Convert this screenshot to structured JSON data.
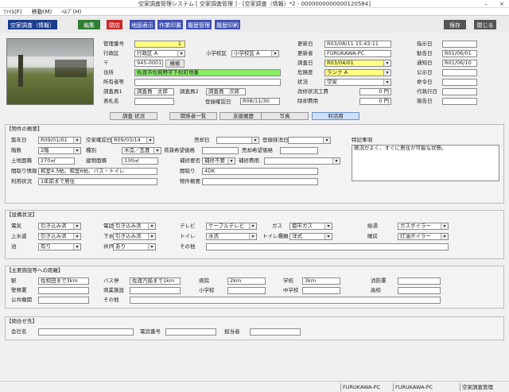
{
  "window": {
    "title": "空家調査管理システム [ 空家調査管理 ] - [空家調査（情報）*2 - 0000000000000120584]",
    "minimize": "–",
    "close": "×"
  },
  "menu": [
    "ﾌｧｲﾙ(F)",
    "移動(M)",
    "ﾍﾙﾌﾟ(H)"
  ],
  "toolbar": {
    "title": "空家調査（情報）",
    "edit": "編集",
    "close_page": "閉店",
    "map": "地図表示",
    "print_list": "作業印書",
    "history": "履歴管理",
    "history_print": "履歴印刷",
    "save": "保存",
    "close": "閉じる"
  },
  "photo_alt": "現地写真",
  "basic": {
    "mgmt_no_label": "管理番号",
    "mgmt_no": "1",
    "ward_label": "行政区",
    "ward": "行政区 A",
    "school_label": "小学校区",
    "school": "小学校区 A",
    "zip_label": "〒",
    "zip": "945-0001",
    "zip_btn": "検索",
    "addr_label": "住所",
    "addr": "佐渡市佐賀野字下松町地番",
    "owner_label": "所有者等",
    "surveyor1_label": "調査員1",
    "surveyor1": "調査員　太郎",
    "surveyor2_label": "調査員2",
    "surveyor2": "調査員　次郎",
    "remarks_label": "表札名",
    "regdate_label": "登録確認日",
    "regdate": "R08/11/30"
  },
  "right": {
    "upd_label": "更新日",
    "upd": "R03/08/11 15:43:11",
    "upd_by_label": "更新者",
    "upd_by": "FURUKAWA-PC",
    "survey_date_label": "調査日",
    "survey_date": "R03/04/01",
    "danger_label": "危険度",
    "danger": "ランク A",
    "status_label": "状況",
    "status": "空家",
    "repair_label": "改修状況工費",
    "repair": "0 円",
    "demol_label": "除却費用",
    "demol": "0 円",
    "d1_label": "指示日",
    "d1": "",
    "d2_label": "勧告日",
    "d2": "R01/06/01",
    "d3_label": "通知日",
    "d3": "R01/06/10",
    "d4_label": "公示日",
    "d4": "",
    "d5_label": "命令日",
    "d5": "",
    "d6_label": "代執行日",
    "d6": "",
    "d7_label": "報告日",
    "d7": ""
  },
  "actions": [
    "調査 状況",
    "関係者一覧",
    "支援履歴",
    "写真",
    "利活用"
  ],
  "prop": {
    "title": "【物件の概要】",
    "built_label": "築年日",
    "built": "R09/01/01",
    "vacant_label": "空家確認日",
    "vacant": "R09/03/14",
    "sale_label": "売却日",
    "sale": "",
    "reg_label": "登録抹消日",
    "reg": "",
    "floors_label": "階数",
    "floors": "2階",
    "struct_label": "種別",
    "struct": "木造／瓦葺",
    "price_label": "賃貸希望価格",
    "price": "",
    "sale_price_label": "売却希望価格",
    "sale_price": "",
    "land_label": "土地面積",
    "land": "270㎡",
    "bldg_label": "建物面積",
    "bldg": "130㎡",
    "repair_need_label": "補修要否",
    "repair_need": "補修不要",
    "repair_cost_label": "補修費用",
    "repair_cost": "",
    "layout_label": "間取り情報",
    "layout": "和室4.5帖、和室6帖、バス・トイレ",
    "status_label": "間取り",
    "status": "4DK",
    "usage_label": "利用状況",
    "usage": "1年前まで居住",
    "notes_label": "特記事項",
    "notes": "現況がよく、すぐに居住が可能な状態。",
    "equip_label": "物件概要",
    "equip": ""
  },
  "equip": {
    "title": "【設備状況】",
    "elec_label": "電気",
    "elec": "引き込み済",
    "tel_label": "電話",
    "tel": "引き込み済",
    "tv_label": "テレビ",
    "tv": "ケーブルテレビ",
    "gas_label": "ガス",
    "gas": "都市ガス",
    "bath_label": "給湯",
    "bath": "ガスボイラー",
    "water_label": "上水道",
    "water": "引き込み済",
    "sewer_label": "下水道",
    "sewer": "引き込み済",
    "toilet_label": "トイレ",
    "toilet": "水洗",
    "toilet_type_label": "トイレ種類",
    "toilet_type": "洋式",
    "heat_label": "暖房",
    "heat": "灯油ボイラー",
    "pond_label": "池",
    "pond": "有り",
    "well_label": "井戸",
    "well": "あり",
    "other_label": "その他",
    "other": ""
  },
  "near": {
    "title": "【主要施設等への距離】",
    "sta_label": "駅",
    "sta": "佐和田まで3km",
    "bus_label": "バス停",
    "bus": "佐渡汽船まで1km",
    "hosp_label": "病院",
    "hosp": "2km",
    "school_label": "学校",
    "school": "3km",
    "fire_label": "消防署",
    "fire": "",
    "police_label": "警察署",
    "police": "",
    "market_label": "商業施設",
    "market": "",
    "elem_label": "小学校",
    "elem": "",
    "jhs_label": "中学校",
    "jhs": "",
    "hs_label": "高校",
    "hs": "",
    "office_label": "公共機関",
    "office": "",
    "other_label": "その他",
    "other": ""
  },
  "contact": {
    "title": "【問合せ先】",
    "company_label": "会社名",
    "company": "",
    "phone_label": "電話番号",
    "phone": "",
    "person_label": "担当者",
    "person": ""
  },
  "status": {
    "pc": "FURUKAWA-PC",
    "user": "FURUKAWA-PC",
    "mode": "空家調査管理"
  },
  "colors": {
    "accent": "#1a3c8e",
    "edit": "#2e7d32",
    "close": "#c62828",
    "tool": "#3f51b5"
  }
}
